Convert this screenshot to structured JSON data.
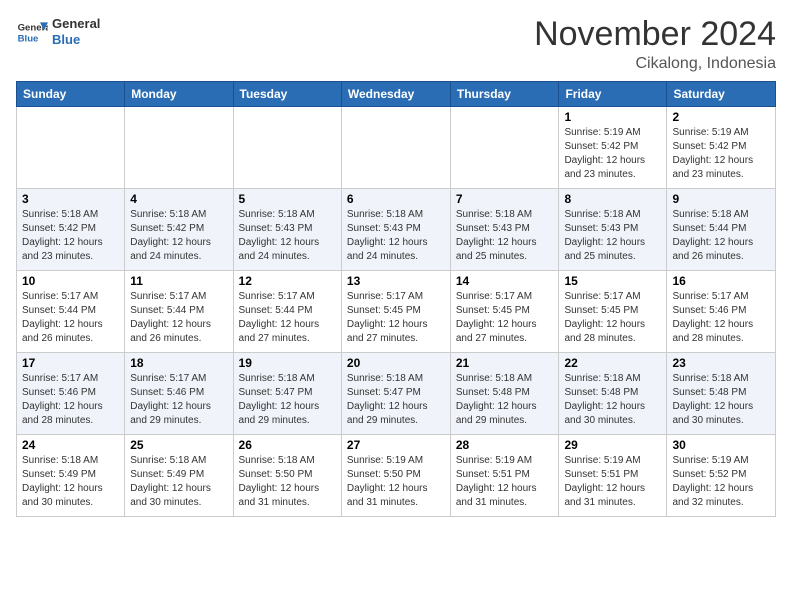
{
  "header": {
    "logo_general": "General",
    "logo_blue": "Blue",
    "month": "November 2024",
    "location": "Cikalong, Indonesia"
  },
  "weekdays": [
    "Sunday",
    "Monday",
    "Tuesday",
    "Wednesday",
    "Thursday",
    "Friday",
    "Saturday"
  ],
  "weeks": [
    [
      {
        "day": "",
        "info": ""
      },
      {
        "day": "",
        "info": ""
      },
      {
        "day": "",
        "info": ""
      },
      {
        "day": "",
        "info": ""
      },
      {
        "day": "",
        "info": ""
      },
      {
        "day": "1",
        "info": "Sunrise: 5:19 AM\nSunset: 5:42 PM\nDaylight: 12 hours\nand 23 minutes."
      },
      {
        "day": "2",
        "info": "Sunrise: 5:19 AM\nSunset: 5:42 PM\nDaylight: 12 hours\nand 23 minutes."
      }
    ],
    [
      {
        "day": "3",
        "info": "Sunrise: 5:18 AM\nSunset: 5:42 PM\nDaylight: 12 hours\nand 23 minutes."
      },
      {
        "day": "4",
        "info": "Sunrise: 5:18 AM\nSunset: 5:42 PM\nDaylight: 12 hours\nand 24 minutes."
      },
      {
        "day": "5",
        "info": "Sunrise: 5:18 AM\nSunset: 5:43 PM\nDaylight: 12 hours\nand 24 minutes."
      },
      {
        "day": "6",
        "info": "Sunrise: 5:18 AM\nSunset: 5:43 PM\nDaylight: 12 hours\nand 24 minutes."
      },
      {
        "day": "7",
        "info": "Sunrise: 5:18 AM\nSunset: 5:43 PM\nDaylight: 12 hours\nand 25 minutes."
      },
      {
        "day": "8",
        "info": "Sunrise: 5:18 AM\nSunset: 5:43 PM\nDaylight: 12 hours\nand 25 minutes."
      },
      {
        "day": "9",
        "info": "Sunrise: 5:18 AM\nSunset: 5:44 PM\nDaylight: 12 hours\nand 26 minutes."
      }
    ],
    [
      {
        "day": "10",
        "info": "Sunrise: 5:17 AM\nSunset: 5:44 PM\nDaylight: 12 hours\nand 26 minutes."
      },
      {
        "day": "11",
        "info": "Sunrise: 5:17 AM\nSunset: 5:44 PM\nDaylight: 12 hours\nand 26 minutes."
      },
      {
        "day": "12",
        "info": "Sunrise: 5:17 AM\nSunset: 5:44 PM\nDaylight: 12 hours\nand 27 minutes."
      },
      {
        "day": "13",
        "info": "Sunrise: 5:17 AM\nSunset: 5:45 PM\nDaylight: 12 hours\nand 27 minutes."
      },
      {
        "day": "14",
        "info": "Sunrise: 5:17 AM\nSunset: 5:45 PM\nDaylight: 12 hours\nand 27 minutes."
      },
      {
        "day": "15",
        "info": "Sunrise: 5:17 AM\nSunset: 5:45 PM\nDaylight: 12 hours\nand 28 minutes."
      },
      {
        "day": "16",
        "info": "Sunrise: 5:17 AM\nSunset: 5:46 PM\nDaylight: 12 hours\nand 28 minutes."
      }
    ],
    [
      {
        "day": "17",
        "info": "Sunrise: 5:17 AM\nSunset: 5:46 PM\nDaylight: 12 hours\nand 28 minutes."
      },
      {
        "day": "18",
        "info": "Sunrise: 5:17 AM\nSunset: 5:46 PM\nDaylight: 12 hours\nand 29 minutes."
      },
      {
        "day": "19",
        "info": "Sunrise: 5:18 AM\nSunset: 5:47 PM\nDaylight: 12 hours\nand 29 minutes."
      },
      {
        "day": "20",
        "info": "Sunrise: 5:18 AM\nSunset: 5:47 PM\nDaylight: 12 hours\nand 29 minutes."
      },
      {
        "day": "21",
        "info": "Sunrise: 5:18 AM\nSunset: 5:48 PM\nDaylight: 12 hours\nand 29 minutes."
      },
      {
        "day": "22",
        "info": "Sunrise: 5:18 AM\nSunset: 5:48 PM\nDaylight: 12 hours\nand 30 minutes."
      },
      {
        "day": "23",
        "info": "Sunrise: 5:18 AM\nSunset: 5:48 PM\nDaylight: 12 hours\nand 30 minutes."
      }
    ],
    [
      {
        "day": "24",
        "info": "Sunrise: 5:18 AM\nSunset: 5:49 PM\nDaylight: 12 hours\nand 30 minutes."
      },
      {
        "day": "25",
        "info": "Sunrise: 5:18 AM\nSunset: 5:49 PM\nDaylight: 12 hours\nand 30 minutes."
      },
      {
        "day": "26",
        "info": "Sunrise: 5:18 AM\nSunset: 5:50 PM\nDaylight: 12 hours\nand 31 minutes."
      },
      {
        "day": "27",
        "info": "Sunrise: 5:19 AM\nSunset: 5:50 PM\nDaylight: 12 hours\nand 31 minutes."
      },
      {
        "day": "28",
        "info": "Sunrise: 5:19 AM\nSunset: 5:51 PM\nDaylight: 12 hours\nand 31 minutes."
      },
      {
        "day": "29",
        "info": "Sunrise: 5:19 AM\nSunset: 5:51 PM\nDaylight: 12 hours\nand 31 minutes."
      },
      {
        "day": "30",
        "info": "Sunrise: 5:19 AM\nSunset: 5:52 PM\nDaylight: 12 hours\nand 32 minutes."
      }
    ]
  ]
}
